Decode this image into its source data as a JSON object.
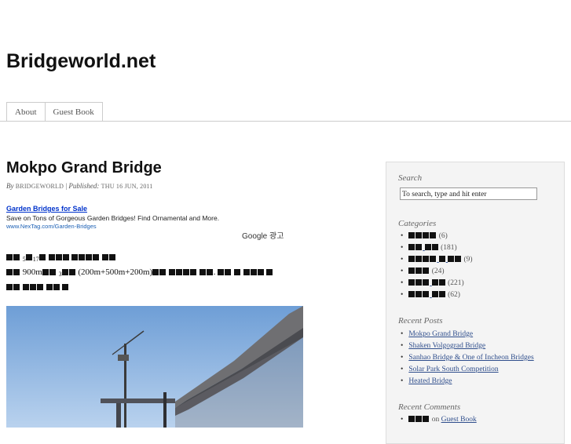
{
  "site": {
    "title": "Bridgeworld.net"
  },
  "nav": {
    "tabs": [
      "About",
      "Guest Book"
    ]
  },
  "post": {
    "title": "Mokpo Grand Bridge",
    "by_label": "By",
    "author": "BRIDGEWORLD",
    "separator": "|",
    "published_label": "Published:",
    "date": "THU 16 JUN, 2011",
    "text_5": "5",
    "text_17": "17",
    "text_900m": "900m",
    "text_3": "3",
    "text_span": "(200m+500m+200m)"
  },
  "ad": {
    "title": "Garden Bridges for Sale",
    "text": "Save on Tons of Gorgeous Garden Bridges! Find Ornamental and More.",
    "url": "www.NexTag.com/Garden-Bridges",
    "brand": "Google 광고"
  },
  "sidebar": {
    "search": {
      "heading": "Search",
      "value": "To search, type and hit enter"
    },
    "categories": {
      "heading": "Categories",
      "counts": [
        "(6)",
        "(181)",
        "(9)",
        "(24)",
        "(221)",
        "(62)"
      ]
    },
    "recent_posts": {
      "heading": "Recent Posts",
      "items": [
        "Mokpo Grand Bridge",
        "Shaken Volgograd Bridge",
        "Sanhao Bridge & One of Incheon Bridges",
        "Solar Park South Competition",
        "Heated Bridge"
      ]
    },
    "recent_comments": {
      "heading": "Recent Comments",
      "on_label": "on",
      "link": "Guest Book"
    }
  },
  "colors": {
    "link": "#2f4e8c",
    "ad_link": "#0033cc"
  }
}
